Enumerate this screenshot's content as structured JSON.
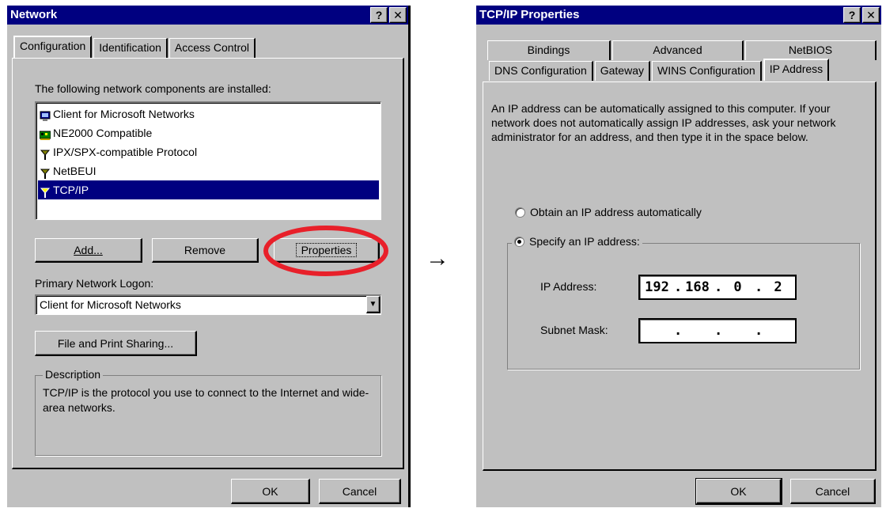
{
  "network": {
    "title": "Network",
    "help_btn": "?",
    "close_btn": "✕",
    "tabs": [
      "Configuration",
      "Identification",
      "Access Control"
    ],
    "installed_label": "The following network components are installed:",
    "components": [
      {
        "label": "Client for Microsoft Networks",
        "icon": "client-icon",
        "selected": false
      },
      {
        "label": "NE2000 Compatible",
        "icon": "network-card-icon",
        "selected": false
      },
      {
        "label": "IPX/SPX-compatible Protocol",
        "icon": "protocol-icon",
        "selected": false
      },
      {
        "label": "NetBEUI",
        "icon": "protocol-icon",
        "selected": false
      },
      {
        "label": "TCP/IP",
        "icon": "protocol-icon",
        "selected": true
      }
    ],
    "add_label": "Add...",
    "remove_label": "Remove",
    "properties_label": "Properties",
    "logon_label": "Primary Network Logon:",
    "logon_value": "Client for Microsoft Networks",
    "file_sharing_label": "File and Print Sharing...",
    "description_title": "Description",
    "description_text": "TCP/IP is the protocol you use to connect to the Internet and wide-area networks.",
    "ok_label": "OK",
    "cancel_label": "Cancel",
    "highlight_color": "#e8202a"
  },
  "arrow": "→",
  "tcpip": {
    "title": "TCP/IP Properties",
    "help_btn": "?",
    "close_btn": "✕",
    "tabs_back": [
      "Bindings",
      "Advanced",
      "NetBIOS"
    ],
    "tabs_front": [
      "DNS Configuration",
      "Gateway",
      "WINS Configuration",
      "IP Address"
    ],
    "info_text": "An IP address can be automatically assigned to this computer. If your network does not automatically assign IP addresses, ask your network administrator for an address, and then type it in the space below.",
    "obtain_label": "Obtain an IP address automatically",
    "specify_label": "Specify an IP address:",
    "ip_label": "IP Address:",
    "ip_octets": [
      "192",
      "168",
      "0",
      "2"
    ],
    "subnet_label": "Subnet Mask:",
    "subnet_octets": [
      "",
      "",
      "",
      ""
    ],
    "ok_label": "OK",
    "cancel_label": "Cancel"
  }
}
